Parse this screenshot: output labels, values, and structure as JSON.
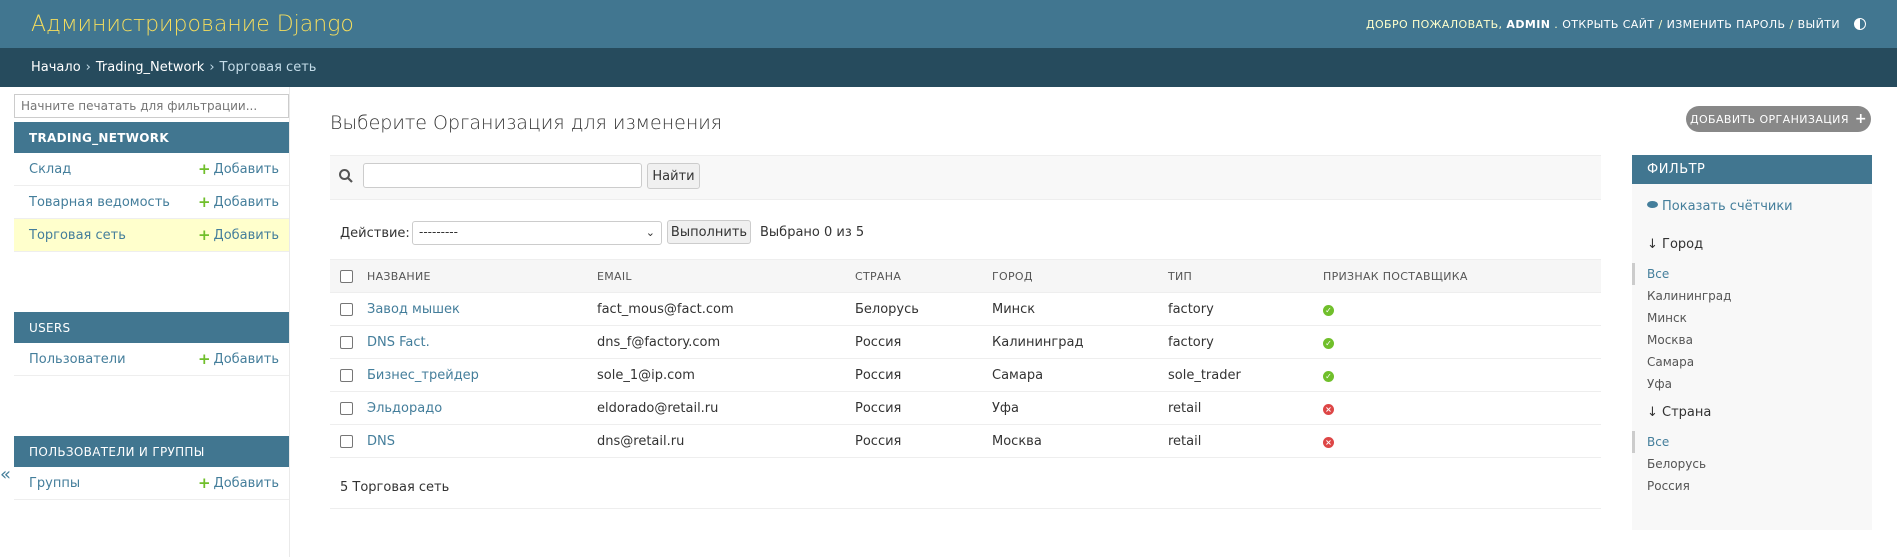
{
  "header": {
    "site_name": "Администрирование Django",
    "welcome": "Добро пожаловать,",
    "username": "ADMIN",
    "open_site": "Открыть сайт",
    "change_password": "Изменить пароль",
    "logout": "Выйти",
    "sep": "/"
  },
  "breadcrumbs": {
    "home": "Начало",
    "app": "Trading_Network",
    "current": "Торговая сеть",
    "sep": "›"
  },
  "sidebar": {
    "filter_placeholder": "Начните печатать для фильтрации...",
    "add_label": "Добавить",
    "modules": [
      {
        "caption": "TRADING_NETWORK",
        "items": [
          "Склад",
          "Товарная ведомость",
          "Торговая сеть"
        ]
      },
      {
        "caption": "USERS",
        "items": [
          "Пользователи"
        ]
      },
      {
        "caption": "ПОЛЬЗОВАТЕЛИ И ГРУППЫ",
        "items": [
          "Группы"
        ]
      }
    ],
    "collapse_icon": "«"
  },
  "main": {
    "title": "Выберите Организация для изменения",
    "add_button": "Добавить Организация",
    "search_button": "Найти",
    "action_label": "Действие:",
    "action_selected": "---------",
    "action_run": "Выполнить",
    "selected_count": "Выбрано 0 из 5",
    "columns": [
      "НАЗВАНИЕ",
      "EMAIL",
      "СТРАНА",
      "ГОРОД",
      "ТИП",
      "ПРИЗНАК ПОСТАВЩИКА"
    ],
    "rows": [
      {
        "name": "Завод мышек",
        "email": "fact_mous@fact.com",
        "country": "Белорусь",
        "city": "Минск",
        "type": "factory",
        "supplier": true
      },
      {
        "name": "DNS Fact.",
        "email": "dns_f@factory.com",
        "country": "Россия",
        "city": "Калининград",
        "type": "factory",
        "supplier": true
      },
      {
        "name": "Бизнес_трейдер",
        "email": "sole_1@ip.com",
        "country": "Россия",
        "city": "Самара",
        "type": "sole_trader",
        "supplier": true
      },
      {
        "name": "Эльдорадо",
        "email": "eldorado@retail.ru",
        "country": "Россия",
        "city": "Уфа",
        "type": "retail",
        "supplier": false
      },
      {
        "name": "DNS",
        "email": "dns@retail.ru",
        "country": "Россия",
        "city": "Москва",
        "type": "retail",
        "supplier": false
      }
    ],
    "paginator": "5 Торговая сеть"
  },
  "filter": {
    "heading": "ФИЛЬТР",
    "show_counts": "Показать счётчики",
    "city_heading": "↓ Город",
    "city_options": [
      "Все",
      "Калининград",
      "Минск",
      "Москва",
      "Самара",
      "Уфа"
    ],
    "country_heading": "↓ Страна",
    "country_options": [
      "Все",
      "Белорусь",
      "Россия"
    ]
  },
  "colors": {
    "header_bg": "#417690",
    "breadcrumb_bg": "#264b5d",
    "site_name": "#f5dd5d",
    "link": "#447e9b",
    "add_green": "#70bf2b",
    "no_red": "#dd4646",
    "current_row": "#ffffcc"
  }
}
